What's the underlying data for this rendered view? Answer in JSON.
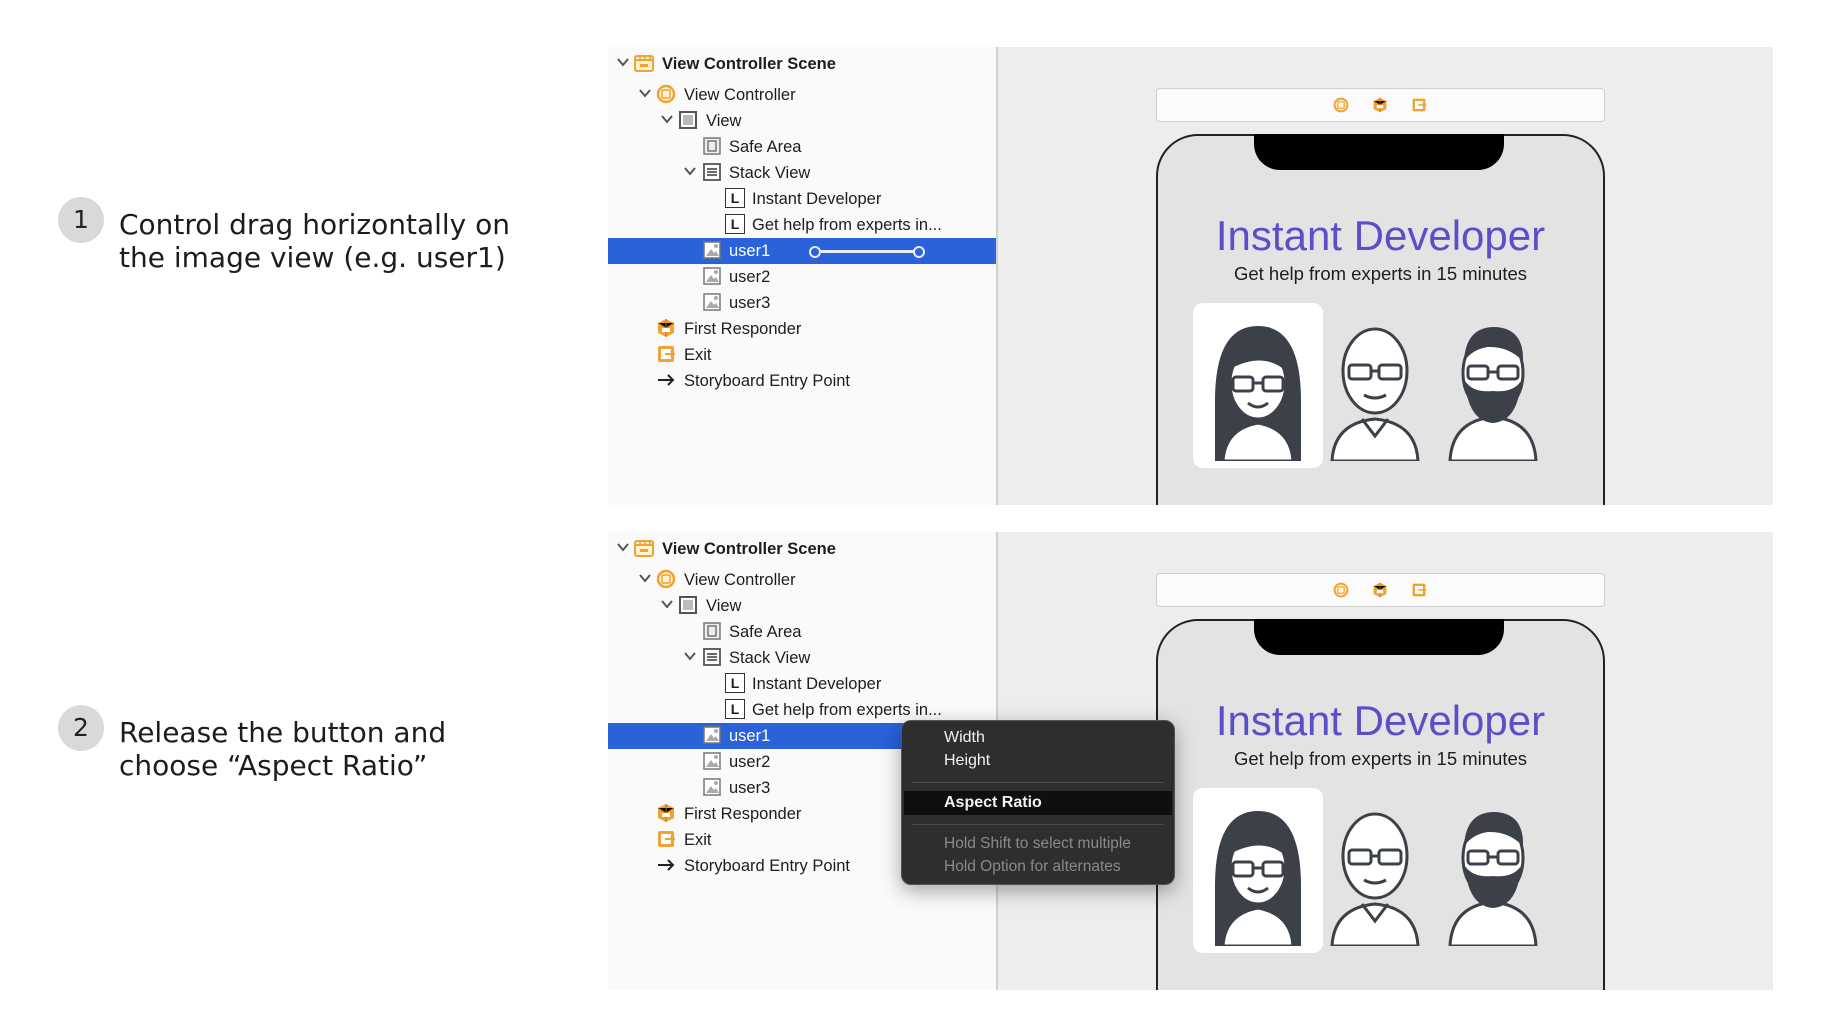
{
  "steps": [
    {
      "number": "1",
      "text": "Control drag horizontally on the image view (e.g. user1)"
    },
    {
      "number": "2",
      "text": "Release the button and choose “Aspect Ratio”"
    }
  ],
  "outline": {
    "scene": "View Controller Scene",
    "view_controller": "View Controller",
    "view": "View",
    "safe_area": "Safe Area",
    "stack_view": "Stack View",
    "label_title": "Instant Developer",
    "label_subtitle": "Get help from experts in...",
    "user1": "user1",
    "user2": "user2",
    "user3": "user3",
    "first_responder": "First Responder",
    "exit": "Exit",
    "entry_point": "Storyboard Entry Point",
    "label_icon_letter": "L"
  },
  "canvas": {
    "title": "Instant Developer",
    "subtitle": "Get help from experts in 15 minutes"
  },
  "menu": {
    "width": "Width",
    "height": "Height",
    "aspect_ratio": "Aspect Ratio",
    "hint1": "Hold Shift to select multiple",
    "hint2": "Hold Option for alternates"
  },
  "colors": {
    "selection": "#2962d9",
    "title": "#5a4fc9",
    "icon_orange": "#f0a233"
  }
}
